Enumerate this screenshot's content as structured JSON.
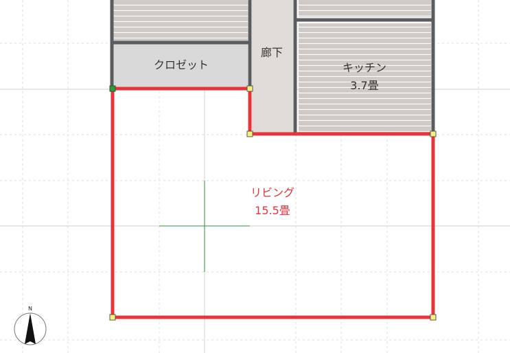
{
  "rooms": {
    "closet": {
      "name": "クロゼット"
    },
    "corridor": {
      "name": "廊下"
    },
    "kitchen": {
      "name": "キッチン",
      "area": "3.7畳"
    },
    "living": {
      "name": "リビング",
      "area": "15.5畳",
      "selected": true
    }
  },
  "compass": {
    "north_label": "N",
    "icon": "north-arrow-icon"
  },
  "colors": {
    "wall": "#5a5c60",
    "selection": "#e8333a",
    "handle": "#f2f27a",
    "start_handle": "#2e9a3e",
    "flooring": "#c9c3be",
    "corridor_floor": "#e2dcd8",
    "closet_floor": "#d9d9d9",
    "grid": "#d8d8d8",
    "center_mark": "#2f8f3a"
  }
}
